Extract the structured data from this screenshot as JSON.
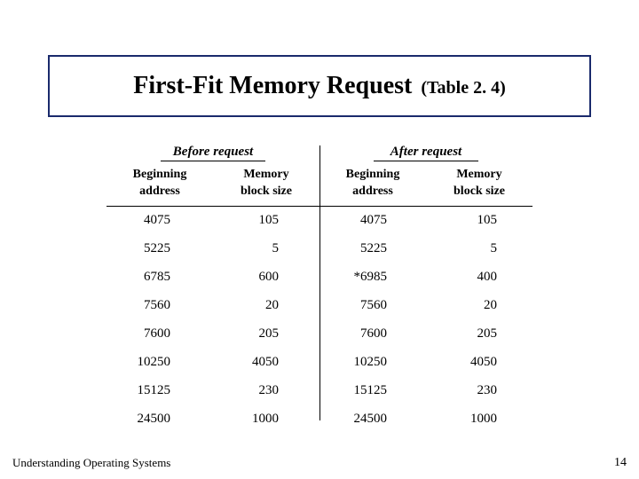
{
  "title": {
    "main": "First-Fit Memory Request",
    "sub": "(Table 2. 4)"
  },
  "chart_data": {
    "type": "table",
    "title": "First-Fit Memory Request (Table 2.4)",
    "sections": [
      {
        "name": "Before request",
        "columns": [
          "Beginning address",
          "Memory block size"
        ],
        "rows": [
          [
            "4075",
            "105"
          ],
          [
            "5225",
            "5"
          ],
          [
            "6785",
            "600"
          ],
          [
            "7560",
            "20"
          ],
          [
            "7600",
            "205"
          ],
          [
            "10250",
            "4050"
          ],
          [
            "15125",
            "230"
          ],
          [
            "24500",
            "1000"
          ]
        ]
      },
      {
        "name": "After request",
        "columns": [
          "Beginning address",
          "Memory block size"
        ],
        "rows": [
          [
            "4075",
            "105"
          ],
          [
            "5225",
            "5"
          ],
          [
            "*6985",
            "400"
          ],
          [
            "7560",
            "20"
          ],
          [
            "7600",
            "205"
          ],
          [
            "10250",
            "4050"
          ],
          [
            "15125",
            "230"
          ],
          [
            "24500",
            "1000"
          ]
        ]
      }
    ]
  },
  "headers": {
    "before": {
      "super": "Before  request",
      "addr1": "Beginning",
      "addr2": "address",
      "size1": "Memory",
      "size2": "block size"
    },
    "after": {
      "super": "After  request",
      "addr1": "Beginning",
      "addr2": "address",
      "size1": "Memory",
      "size2": "block size"
    }
  },
  "footer": {
    "source": "Understanding Operating Systems",
    "page": "14"
  }
}
